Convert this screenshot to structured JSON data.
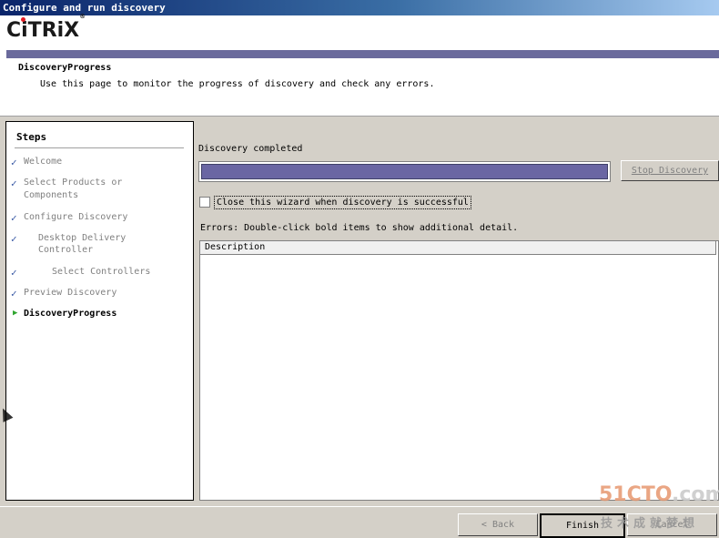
{
  "window": {
    "title": "Configure and run discovery"
  },
  "header": {
    "logo_text": "CiTRiX",
    "page_title": "DiscoveryProgress",
    "description": "Use this page to monitor the progress of discovery and check any errors."
  },
  "steps": {
    "title": "Steps",
    "items": [
      {
        "label": "Welcome"
      },
      {
        "label": "Select Products or"
      },
      {
        "label": "Components"
      },
      {
        "label": "Configure Discovery"
      },
      {
        "label": "Desktop Delivery"
      },
      {
        "label": "Controller"
      },
      {
        "label": "Select Controllers"
      },
      {
        "label": "Preview Discovery"
      },
      {
        "label": "DiscoveryProgress"
      }
    ]
  },
  "main": {
    "status": "Discovery completed",
    "progress_fraction": 1.0,
    "stop_button": "Stop Discovery",
    "close_checkbox": {
      "label": "Close this wizard when discovery is successful",
      "checked": false
    },
    "errors_label": "Errors: Double-click bold items to show additional detail.",
    "grid": {
      "columns": [
        "Description"
      ],
      "rows": []
    }
  },
  "footer": {
    "back_label": "Back",
    "finish_label": "Finish",
    "cancel_label": "Cancel"
  },
  "watermark": {
    "line1_a": "51CTO",
    "line1_b": ".com",
    "line2": "技术成就梦想"
  },
  "colors": {
    "title_bar": "#0a246a",
    "brand_bar": "#6a6a9c",
    "progress_fill": "#6a66a3",
    "check": "#3a5aa5",
    "current_arrow": "#2fa52f"
  }
}
